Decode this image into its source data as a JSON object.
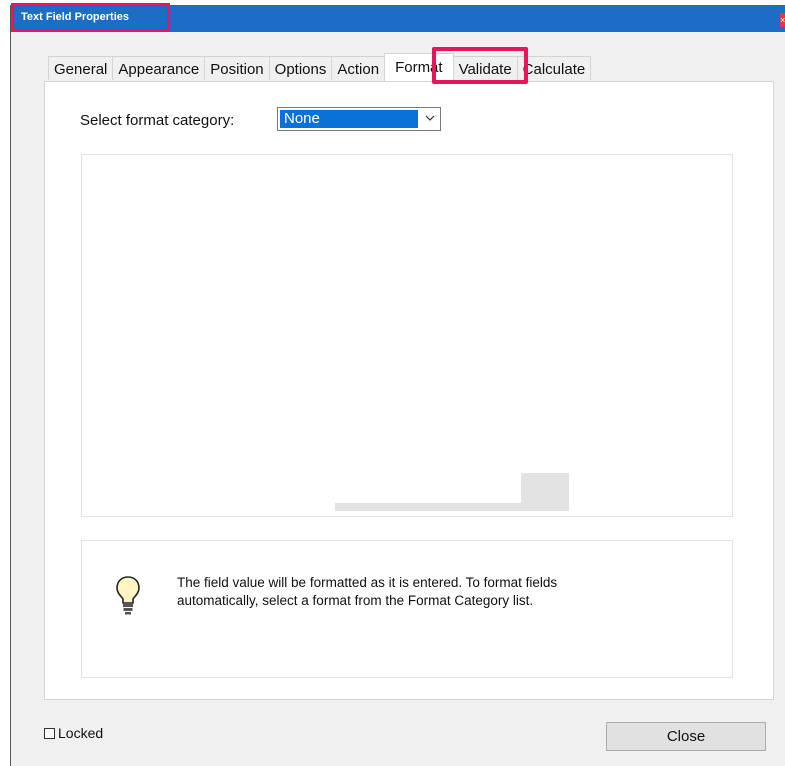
{
  "window": {
    "title": "Text Field Properties",
    "close_glyph": "×"
  },
  "tabs": [
    {
      "label": "General"
    },
    {
      "label": "Appearance"
    },
    {
      "label": "Position"
    },
    {
      "label": "Options"
    },
    {
      "label": "Action"
    },
    {
      "label": "Format",
      "active": true
    },
    {
      "label": "Validate"
    },
    {
      "label": "Calculate"
    }
  ],
  "format": {
    "category_label": "Select format category:",
    "category_value": "None"
  },
  "info": {
    "icon": "lightbulb-icon",
    "text": "The field value will be formatted as it is entered. To format fields automatically, select a format from the Format Category list."
  },
  "footer": {
    "locked_label": "Locked",
    "locked_checked": false,
    "close_label": "Close"
  },
  "colors": {
    "titlebar": "#1c6ec4",
    "highlight": "#e8155a",
    "selection": "#0a72d6"
  }
}
